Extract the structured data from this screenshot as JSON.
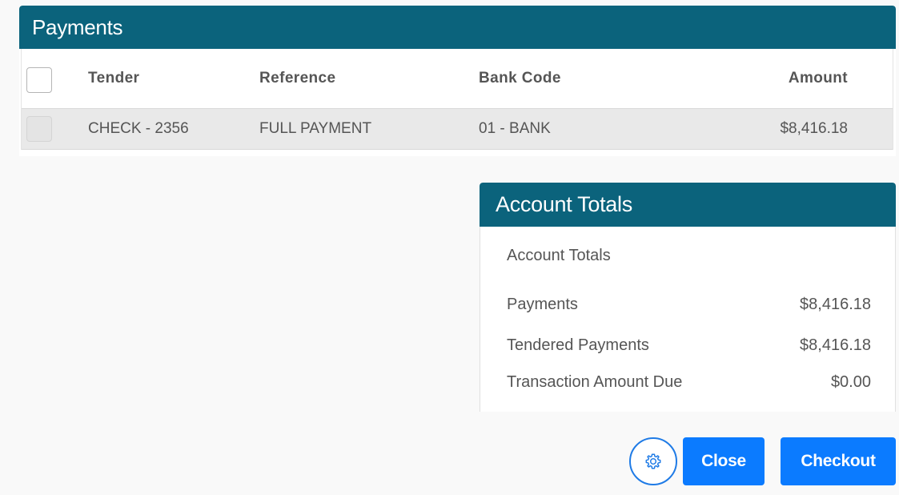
{
  "payments": {
    "title": "Payments",
    "columns": {
      "tender": "Tender",
      "reference": "Reference",
      "bank_code": "Bank Code",
      "amount": "Amount"
    },
    "rows": [
      {
        "tender": "CHECK - 2356",
        "reference": "FULL PAYMENT",
        "bank_code": "01 - BANK",
        "amount": "$8,416.18",
        "checked": false
      }
    ],
    "select_all_checked": false
  },
  "account_totals": {
    "title": "Account Totals",
    "subtitle": "Account Totals",
    "rows": [
      {
        "label": "Payments",
        "value": "$8,416.18"
      },
      {
        "label": "Tendered Payments",
        "value": "$8,416.18"
      },
      {
        "label": "Transaction Amount Due",
        "value": "$0.00"
      }
    ]
  },
  "footer": {
    "settings_icon": "gear-icon",
    "close_label": "Close",
    "checkout_label": "Checkout"
  },
  "colors": {
    "panel_header": "#0b637c",
    "primary_button": "#0b7bff",
    "settings_border": "#1f7be6",
    "selected_row": "#e9e9e9"
  }
}
